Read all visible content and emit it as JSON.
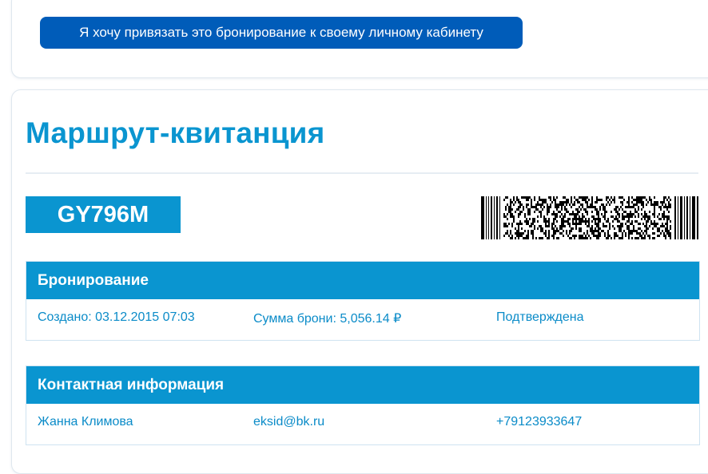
{
  "top": {
    "link_button_label": "Я хочу привязать это бронирование к своему личному кабинету"
  },
  "ticket": {
    "title": "Маршрут-квитанция",
    "booking_code": "GY796M"
  },
  "booking": {
    "header": "Бронирование",
    "created": "Создано: 03.12.2015 07:03",
    "amount": "Сумма брони: 5,056.14 ₽",
    "status": "Подтверждена"
  },
  "contact": {
    "header": "Контактная информация",
    "name": "Жанна Климова",
    "email": "eksid@bk.ru",
    "phone": "+79123933647"
  },
  "colors": {
    "brand_blue": "#0a95d0",
    "button_blue": "#005cb9",
    "text_blue": "#0a8bc8"
  }
}
